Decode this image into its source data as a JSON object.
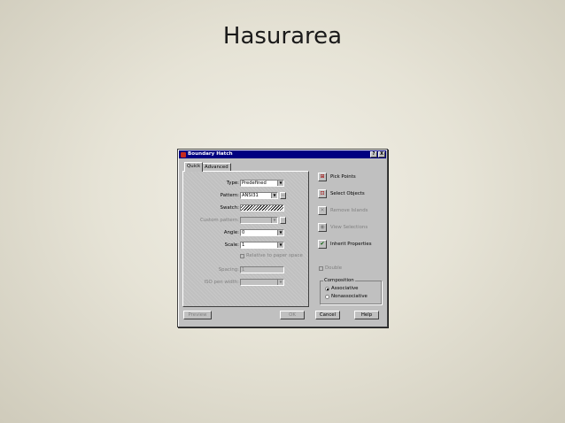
{
  "slide": {
    "title": "Hasurarea"
  },
  "dialog": {
    "title": "Boundary Hatch",
    "title_buttons": [
      "?",
      "X"
    ],
    "tabs": [
      {
        "label": "Quick"
      },
      {
        "label": "Advanced"
      }
    ],
    "quick": {
      "type_label": "Type:",
      "type_value": "Predefined",
      "pattern_label": "Pattern:",
      "pattern_value": "ANSI31",
      "swatch_label": "Swatch:",
      "custom_pattern_label": "Custom pattern:",
      "custom_pattern_value": "",
      "angle_label": "Angle:",
      "angle_value": "0",
      "scale_label": "Scale:",
      "scale_value": "1",
      "relative_label": "Relative to paper space",
      "spacing_label": "Spacing:",
      "spacing_value": "1",
      "iso_pen_label": "ISO pen width:",
      "iso_pen_value": ""
    },
    "actions": {
      "pick_points": "Pick Points",
      "select_objects": "Select Objects",
      "remove_islands": "Remove Islands",
      "view_selections": "View Selections",
      "inherit_properties": "Inherit Properties",
      "double_label": "Double"
    },
    "composition": {
      "title": "Composition",
      "associative": "Associative",
      "nonassociative": "Nonassociative",
      "selected": "Associative"
    },
    "buttons": {
      "preview": "Preview",
      "ok": "OK",
      "cancel": "Cancel",
      "help": "Help"
    }
  }
}
